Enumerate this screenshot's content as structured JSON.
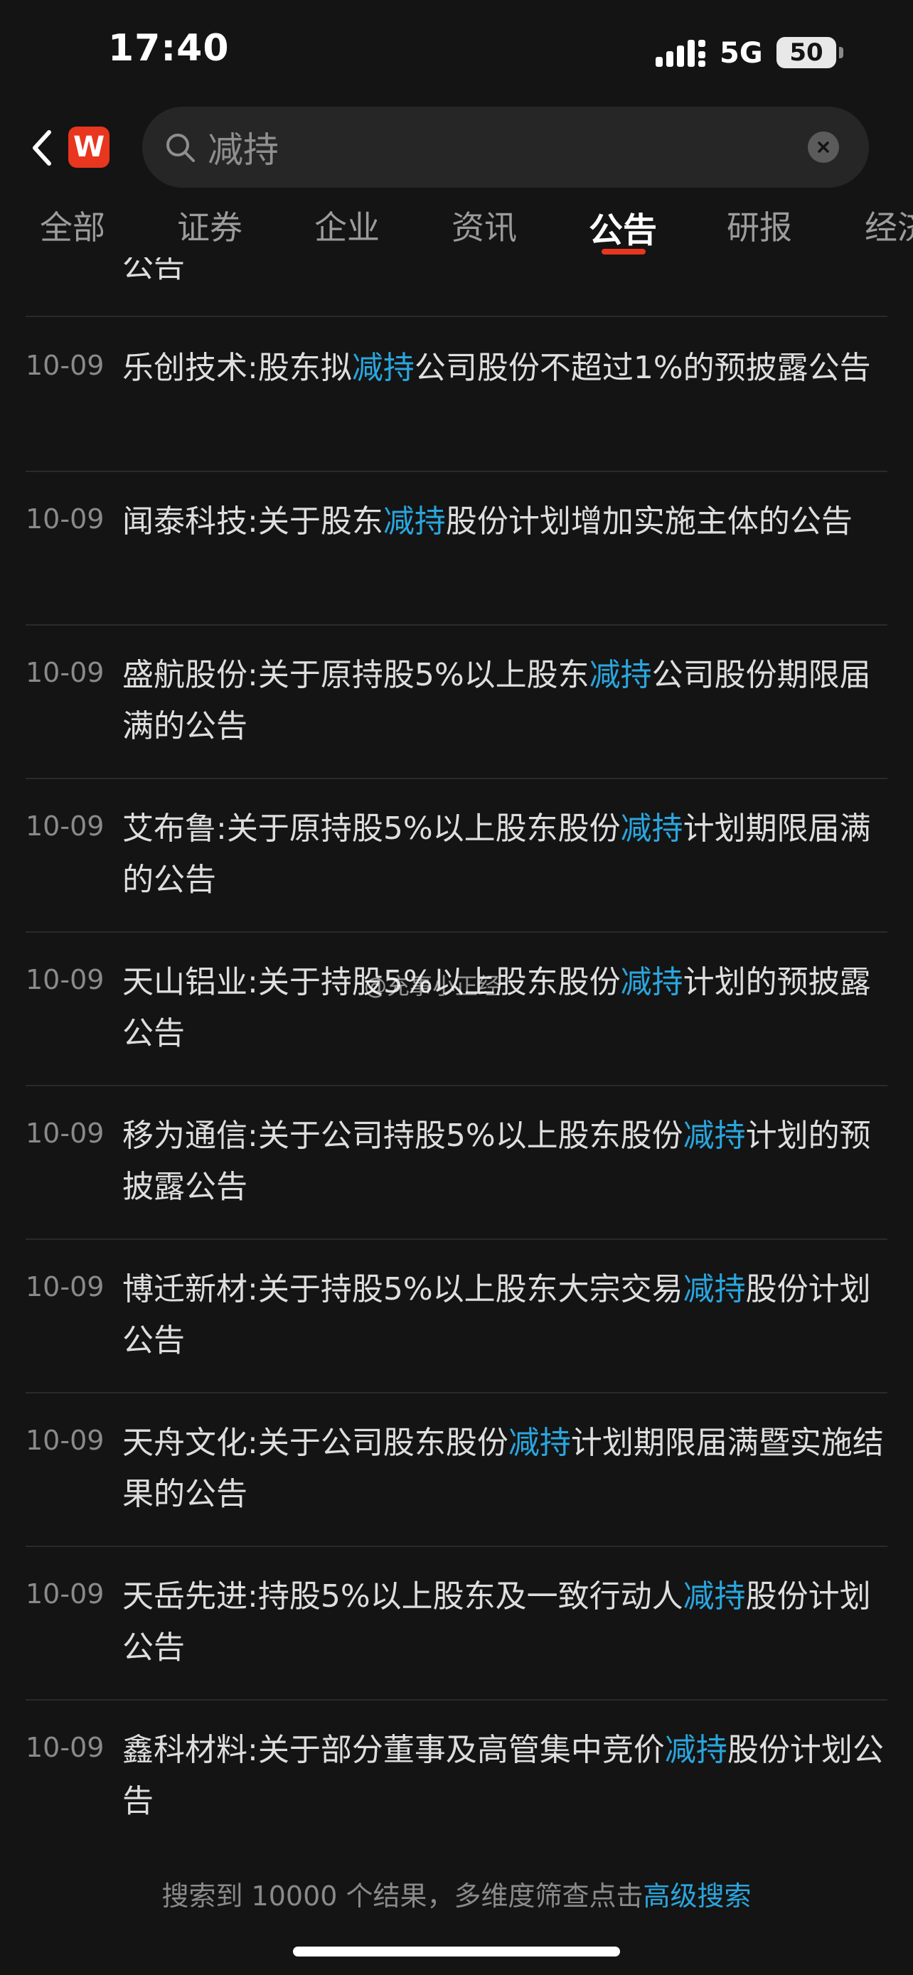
{
  "status_bar": {
    "time": "17:40",
    "network": "5G",
    "battery": "50"
  },
  "header": {
    "logo_text": "W",
    "search": {
      "value": "减持"
    }
  },
  "tabs": [
    {
      "label": "全部",
      "active": false
    },
    {
      "label": "证券",
      "active": false
    },
    {
      "label": "企业",
      "active": false
    },
    {
      "label": "资讯",
      "active": false
    },
    {
      "label": "公告",
      "active": true
    },
    {
      "label": "研报",
      "active": false
    },
    {
      "label": "经济",
      "active": false
    }
  ],
  "partial_item": {
    "text": "公告"
  },
  "items": [
    {
      "date": "10-09",
      "before": "乐创技术:股东拟",
      "keyword": "减持",
      "after": "公司股份不超过1%的预披露公告"
    },
    {
      "date": "10-09",
      "before": "闻泰科技:关于股东",
      "keyword": "减持",
      "after": "股份计划增加实施主体的公告"
    },
    {
      "date": "10-09",
      "before": "盛航股份:关于原持股5%以上股东",
      "keyword": "减持",
      "after": "公司股份期限届满的公告"
    },
    {
      "date": "10-09",
      "before": "艾布鲁:关于原持股5%以上股东股份",
      "keyword": "减持",
      "after": "计划期限届满的公告"
    },
    {
      "date": "10-09",
      "before": "天山铝业:关于持股5%以上股东股份",
      "keyword": "减持",
      "after": "计划的预披露公告"
    },
    {
      "date": "10-09",
      "before": "移为通信:关于公司持股5%以上股东股份",
      "keyword": "减持",
      "after": "计划的预披露公告"
    },
    {
      "date": "10-09",
      "before": "博迁新材:关于持股5%以上股东大宗交易",
      "keyword": "减持",
      "after": "股份计划公告"
    },
    {
      "date": "10-09",
      "before": "天舟文化:关于公司股东股份",
      "keyword": "减持",
      "after": "计划期限届满暨实施结果的公告"
    },
    {
      "date": "10-09",
      "before": "天岳先进:持股5%以上股东及一致行动人",
      "keyword": "减持",
      "after": "股份计划公告"
    },
    {
      "date": "10-09",
      "before": "鑫科材料:关于部分董事及高管集中竞价",
      "keyword": "减持",
      "after": "股份计划公告"
    }
  ],
  "watermark": "@充事小正经",
  "footer": {
    "text": "搜索到 10000 个结果，多维度筛查点击",
    "link": "高级搜索"
  },
  "colors": {
    "background": "#141414",
    "highlight": "#2aa6de",
    "accent": "#e8361f"
  }
}
